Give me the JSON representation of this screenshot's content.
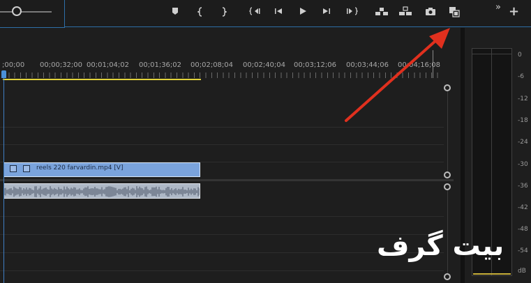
{
  "transport": {
    "marker_icon": "marker-icon",
    "mark_in_icon": "mark-in-icon",
    "mark_out_icon": "mark-out-icon",
    "go_to_in_icon": "go-to-in-icon",
    "step_back_icon": "step-back-icon",
    "play_icon": "play-icon",
    "step_forward_icon": "step-forward-icon",
    "go_to_out_icon": "go-to-out-icon",
    "lift_icon": "lift-icon",
    "extract_icon": "extract-icon",
    "export_frame_icon": "camera-icon",
    "compare_icon": "comparison-view-icon",
    "more_label": "»",
    "add_label": "+"
  },
  "ruler": {
    "labels": [
      ";00;00",
      "00;00;32;00",
      "00;01;04;02",
      "00;01;36;02",
      "00;02;08;04",
      "00;02;40;04",
      "00;03;12;06",
      "00;03;44;06",
      "00;04;16;08"
    ]
  },
  "video_clip": {
    "name": "reels 220 farvardin.mp4 [V]"
  },
  "meter": {
    "scale": [
      "0",
      "-6",
      "-12",
      "-18",
      "-24",
      "-30",
      "-36",
      "-42",
      "-48",
      "-54",
      "dB"
    ]
  },
  "watermark": {
    "text": "بیت گرف"
  },
  "colors": {
    "accent": "#2e6fa8",
    "clip_video": "#7aa3dc",
    "clip_audio": "#aeb8c6",
    "work_area": "#e2d33b",
    "arrow": "#e0301e"
  }
}
